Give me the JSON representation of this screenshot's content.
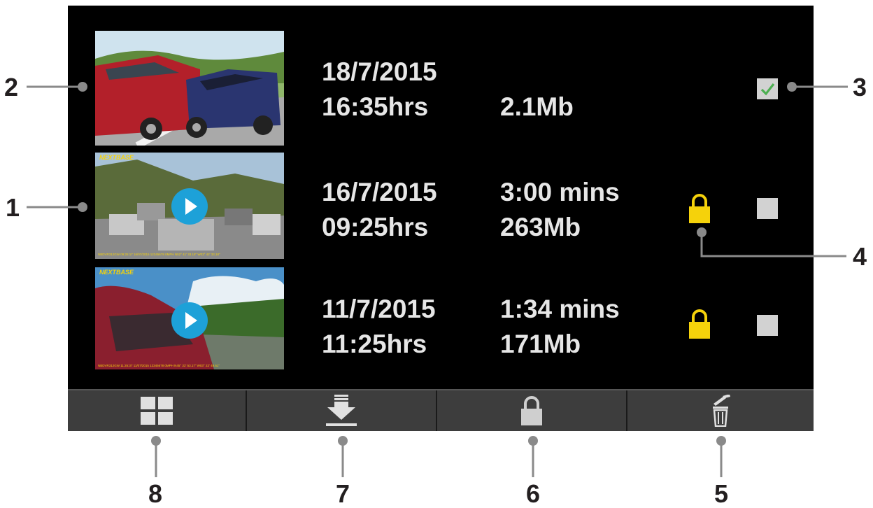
{
  "files": [
    {
      "date": "18/7/2015",
      "time": "16:35hrs",
      "duration": "",
      "size": "2.1Mb",
      "type": "photo",
      "locked": false,
      "selected": true,
      "overlay_brand": ""
    },
    {
      "date": "16/7/2015",
      "time": "09:25hrs",
      "duration": "3:00 mins",
      "size": "263Mb",
      "type": "video",
      "locked": true,
      "selected": false,
      "overlay_brand": "NEXTBASE",
      "overlay_info": "NBDVR312GW  09:25:17  16/07/2015  12345678  0MPH  N52° 41' 33.18\" W03° 42' 33.18\""
    },
    {
      "date": "11/7/2015",
      "time": "11:25hrs",
      "duration": "1:34 mins",
      "size": "171Mb",
      "type": "video",
      "locked": true,
      "selected": false,
      "overlay_brand": "NEXTBASE",
      "overlay_info": "NBDVR312GW  11:25:37  11/07/2015  12345678  0MPH  N45° 22' 53.17\" W03° 22' 49.61\""
    }
  ],
  "callouts": [
    "1",
    "2",
    "3",
    "4",
    "5",
    "6",
    "7",
    "8"
  ],
  "toolbar": [
    "grid-view-icon",
    "download-icon",
    "lock-icon",
    "delete-icon"
  ],
  "colors": {
    "accent_play": "#1da1d8",
    "lock_yellow": "#f5d20b",
    "check_green": "#4caf50",
    "toolbar_bg": "#3d3d3d"
  }
}
